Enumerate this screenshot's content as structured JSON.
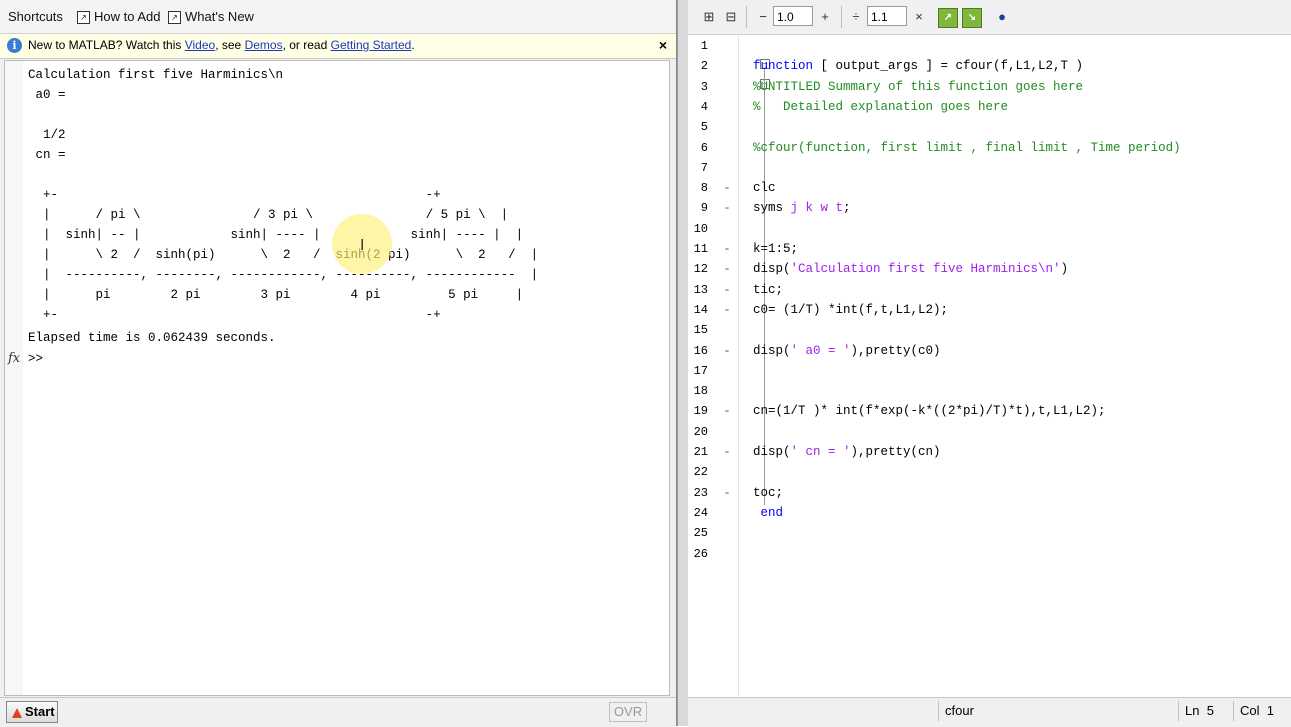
{
  "shortcuts_bar": {
    "items": [
      "Shortcuts",
      "How to Add",
      "What's New"
    ]
  },
  "notice": {
    "prefix": "New to MATLAB? Watch this ",
    "video_link": "Video",
    "middle": ", see ",
    "demos_link": "Demos",
    "or_read": ", or read ",
    "getting_started_link": "Getting Started",
    "suffix": ".",
    "close": "×"
  },
  "command_window": {
    "lines": [
      "Calculation first five Harminics\\n",
      " a0 =",
      "",
      "  1/2",
      " cn =",
      "",
      "  +-                                                 -+",
      "  |      / pi \\               / 3 pi \\               / 5 pi \\  |",
      "  |  sinh| -- |            sinh| ---- |            sinh| ---- |  |",
      "  |      \\ 2  /  sinh(pi)      \\  2   /  sinh(2 pi)      \\  2   /  |",
      "  |  ----------, --------, ------------, ----------, ------------  |",
      "  |      pi        2 pi        3 pi        4 pi         5 pi     |",
      "  +-                                                 -+",
      "Elapsed time is 0.062439 seconds.",
      ">> "
    ],
    "fx_label": "fx"
  },
  "status_left": {
    "start_label": "Start",
    "ovr": "OVR"
  },
  "editor_toolbar": {
    "minus": "−",
    "spacing_value": "1.0",
    "plus": "+",
    "divide": "÷",
    "ratio_value": "1.1",
    "times": "×"
  },
  "editor": {
    "line_numbers": [
      "1",
      "2",
      "3",
      "4",
      "5",
      "6",
      "7",
      "8",
      "9",
      "10",
      "11",
      "12",
      "13",
      "14",
      "15",
      "16",
      "17",
      "18",
      "19",
      "20",
      "21",
      "22",
      "23",
      "24",
      "25",
      "26"
    ],
    "code": [
      [],
      [
        {
          "t": "function",
          "c": "kw"
        },
        {
          "t": " [ output_args ] = cfour(f,L1,L2,T )",
          "c": ""
        }
      ],
      [
        {
          "t": "%UNTITLED Summary of this function goes here",
          "c": "cm"
        }
      ],
      [
        {
          "t": "%   Detailed explanation goes here",
          "c": "cm"
        }
      ],
      [],
      [
        {
          "t": "%cfour(function, first limit , final limit , Time period)",
          "c": "cm"
        }
      ],
      [],
      [
        {
          "t": "clc",
          "c": ""
        }
      ],
      [
        {
          "t": "syms ",
          "c": ""
        },
        {
          "t": "j k w t",
          "c": "st"
        },
        {
          "t": ";",
          "c": ""
        }
      ],
      [],
      [
        {
          "t": "k=1:5;",
          "c": ""
        }
      ],
      [
        {
          "t": "disp(",
          "c": ""
        },
        {
          "t": "'Calculation first five Harminics\\n'",
          "c": "st"
        },
        {
          "t": ")",
          "c": ""
        }
      ],
      [
        {
          "t": "tic;",
          "c": ""
        }
      ],
      [
        {
          "t": "c0= (1/T) *int(f,t,L1,L2);",
          "c": ""
        }
      ],
      [],
      [
        {
          "t": "disp(",
          "c": ""
        },
        {
          "t": "' a0 = '",
          "c": "st"
        },
        {
          "t": "),pretty(c0)",
          "c": ""
        }
      ],
      [],
      [],
      [
        {
          "t": "cn=(1/T )* int(f*exp(-k*((2*pi)/T)*t),t,L1,L2);",
          "c": ""
        }
      ],
      [],
      [
        {
          "t": "disp(",
          "c": ""
        },
        {
          "t": "' cn = '",
          "c": "st"
        },
        {
          "t": "),pretty(cn)",
          "c": ""
        }
      ],
      [],
      [
        {
          "t": "toc;",
          "c": ""
        }
      ],
      [
        {
          "t": " end",
          "c": "kw"
        }
      ],
      [],
      []
    ]
  },
  "status_right": {
    "function_name": "cfour",
    "ln_label": "Ln",
    "ln_value": "5",
    "col_label": "Col",
    "col_value": "1"
  }
}
